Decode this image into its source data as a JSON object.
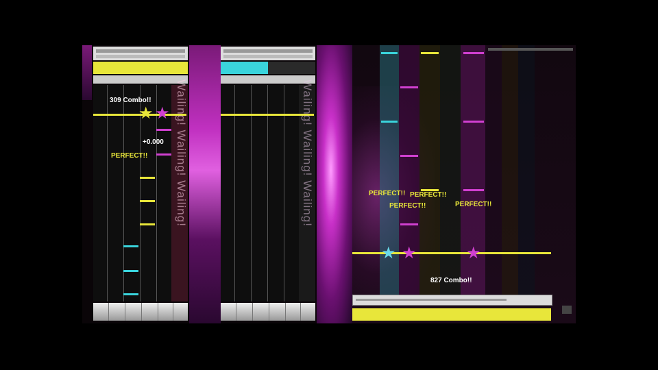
{
  "player1": {
    "combo_text": "309 Combo!!",
    "offset_text": "+0.000",
    "judge_text": "PERFECT!!",
    "wailing_text": "Wailing! Wailing! Wailing!",
    "gauge_fill": 1.0
  },
  "player2": {
    "wailing_text": "Wailing! Wailing! Wailing!",
    "gauge_fill": 0.5
  },
  "drums": {
    "judge_texts": [
      "PERFECT!!",
      "PERFECT!!",
      "PERFECT!!",
      "PERFECT!!"
    ],
    "combo_text": "827 Combo!!",
    "gauge_fill": 1.0
  },
  "colors": {
    "accent_yellow": "#e8e63a",
    "accent_cyan": "#3ad4dc",
    "accent_magenta": "#d040d0",
    "background": "#000000"
  },
  "icons": {
    "hit_star": "star-icon"
  }
}
